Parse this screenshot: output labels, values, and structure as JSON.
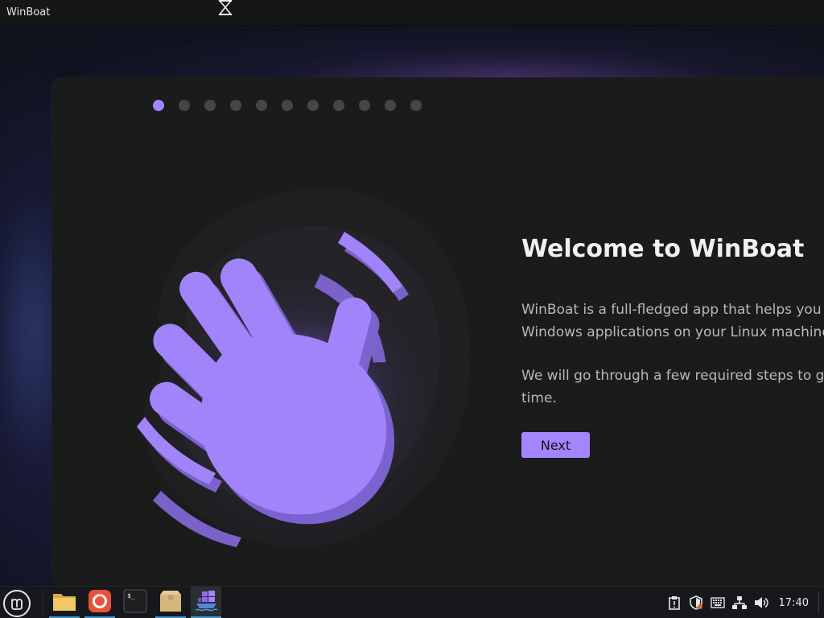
{
  "window": {
    "title": "WinBoat"
  },
  "onboarding": {
    "steps_total": 11,
    "step_current": 1,
    "heading": "Welcome to WinBoat",
    "paragraph1_line1": "WinBoat is a full-fledged app that helps you r",
    "paragraph1_line2": "Windows applications on your Linux machine",
    "paragraph2_line1": "We will go through a few required steps to ge",
    "paragraph2_line2": "time.",
    "next_label": "Next",
    "accent_color": "#a584ff",
    "illustration_icon": "waving-hand-icon"
  },
  "taskbar": {
    "menu_icon": "linux-mint-logo-icon",
    "launchers": [
      {
        "name": "files",
        "icon": "folder-icon"
      },
      {
        "name": "firefox",
        "icon": "firefox-icon"
      },
      {
        "name": "terminal",
        "icon": "terminal-icon"
      },
      {
        "name": "archive-manager",
        "icon": "package-icon"
      },
      {
        "name": "winboat",
        "icon": "winboat-icon"
      }
    ],
    "tray_icons": [
      "clipboard-icon",
      "shield-update-icon",
      "keyboard-icon",
      "network-icon",
      "volume-icon"
    ],
    "clock": "17:40"
  }
}
